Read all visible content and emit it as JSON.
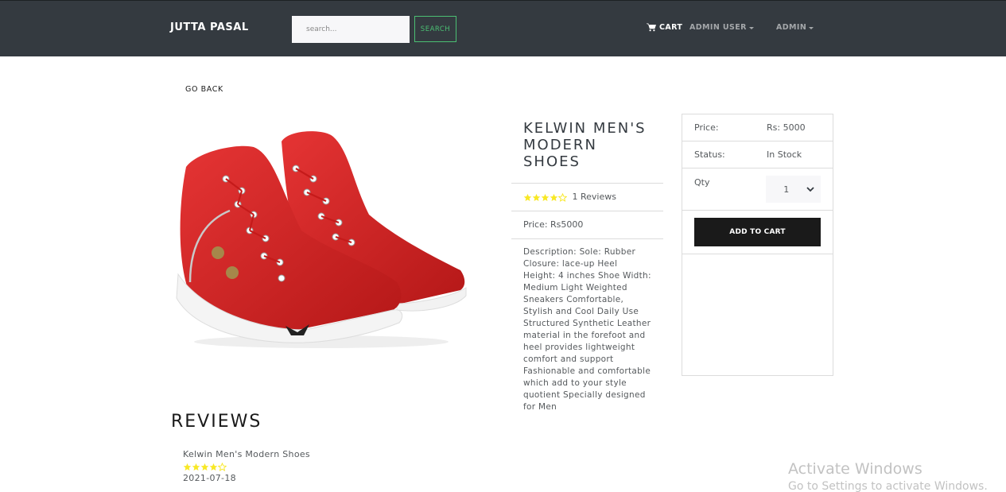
{
  "navbar": {
    "brand": "JUTTA PASAL",
    "search_placeholder": "search...",
    "search_button": "SEARCH",
    "cart_label": "CART",
    "user_menu": "ADMIN USER",
    "admin_menu": "ADMIN"
  },
  "go_back": "GO BACK",
  "product": {
    "name": "KELWIN MEN'S MODERN SHOES",
    "rating": 4,
    "reviews_text": "1 Reviews",
    "price_line": "Price: Rs5000",
    "description": "Description: Sole: Rubber Closure: lace-up Heel Height: 4 inches Shoe Width: Medium Light Weighted Sneakers Comfortable, Stylish and Cool Daily Use Structured Synthetic Leather material in the forefoot and heel provides lightweight comfort and support Fashionable and comfortable which add to your style quotient Specially designed for Men"
  },
  "card": {
    "price_label": "Price:",
    "price_value": "Rs: 5000",
    "status_label": "Status:",
    "status_value": "In Stock",
    "qty_label": "Qty",
    "qty_value": "1",
    "add_to_cart": "ADD TO CART"
  },
  "reviews": {
    "title": "REVIEWS",
    "items": [
      {
        "name": "Kelwin Men's Modern Shoes",
        "rating": 4,
        "date": "2021-07-18"
      }
    ]
  },
  "watermark": {
    "title": "Activate Windows",
    "subtitle": "Go to Settings to activate Windows."
  },
  "colors": {
    "navbar": "#343a40",
    "accent_green": "#4bbf73",
    "star": "#f8e825",
    "button_dark": "#1a1a1a",
    "shoe_red": "#d62424"
  },
  "icons": [
    "cart-icon",
    "caret-down-icon",
    "star-icon",
    "chevron-down-icon"
  ]
}
